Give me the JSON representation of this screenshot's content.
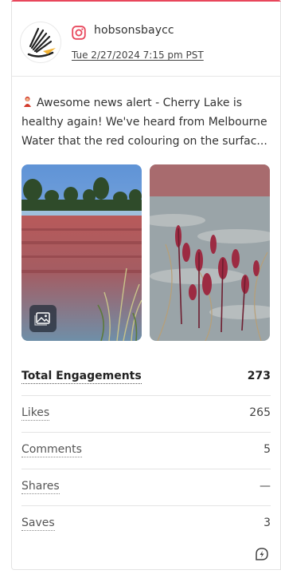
{
  "post": {
    "network": "instagram-icon",
    "account": "hobsonsbaycc",
    "timestamp": "Tue 2/27/2024 7:15 pm PST",
    "text": "Awesome news alert - Cherry Lake is healthy again! We've heard from Melbourne Water that the red colouring on the surfac...",
    "accent_color": "#e8465b"
  },
  "metrics": {
    "rows": [
      {
        "label": "Total Engagements",
        "value": "273"
      },
      {
        "label": "Likes",
        "value": "265"
      },
      {
        "label": "Comments",
        "value": "5"
      },
      {
        "label": "Shares",
        "value": "—"
      },
      {
        "label": "Saves",
        "value": "3"
      }
    ]
  }
}
